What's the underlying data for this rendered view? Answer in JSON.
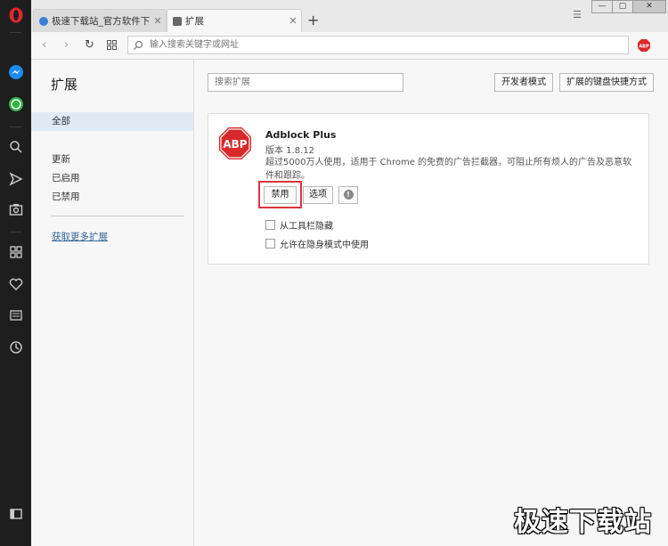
{
  "tabs": [
    {
      "title": "极速下载站_官方软件下载",
      "close": "✕"
    },
    {
      "title": "扩展",
      "close": "✕"
    }
  ],
  "new_tab_label": "+",
  "tab_menu_icon": "☰",
  "window_controls": {
    "minimize": "—",
    "maximize": "▢",
    "close": "✕"
  },
  "nav": {
    "back": "‹",
    "forward": "›",
    "reload": "↻"
  },
  "address_bar": {
    "placeholder": "输入搜索关键字或网址"
  },
  "sidebar_icons": [
    "opera-logo-icon",
    "messenger-icon",
    "whatsapp-icon",
    "search-icon",
    "send-icon",
    "camera-icon",
    "speed-dial-icon",
    "heart-icon",
    "news-icon",
    "history-icon",
    "sidebar-toggle-icon"
  ],
  "left_nav": {
    "title": "扩展",
    "items": [
      {
        "label": "全部",
        "selected": true
      },
      {
        "label": "更新",
        "selected": false
      },
      {
        "label": "已启用",
        "selected": false
      },
      {
        "label": "已禁用",
        "selected": false
      }
    ],
    "more_link": "获取更多扩展"
  },
  "main": {
    "search_placeholder": "搜索扩展",
    "dev_mode_button": "开发者模式",
    "shortcuts_button": "扩展的键盘快捷方式"
  },
  "extension": {
    "logo_text": "ABP",
    "name": "Adblock Plus",
    "version": "版本 1.8.12",
    "description": "超过5000万人使用，适用于 Chrome 的免费的广告拦截器，可阻止所有烦人的广告及恶意软件和跟踪。",
    "disable_button": "禁用",
    "options_button": "选项",
    "info_icon": "!",
    "checkbox_hide_toolbar": "从工具栏隐藏",
    "checkbox_incognito": "允许在隐身模式中使用"
  },
  "colors": {
    "sidebar": "#1e1e1e",
    "opera_red": "#e3262d",
    "abp_red": "#d9292b",
    "highlight": "#d9363e",
    "link": "#336699"
  },
  "watermark": "极速下载站"
}
